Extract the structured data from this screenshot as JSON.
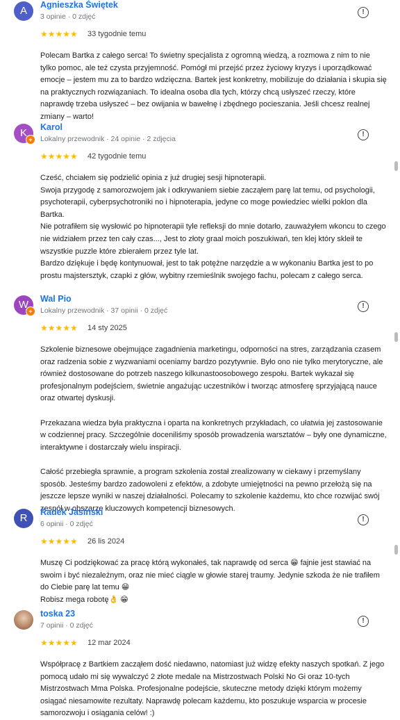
{
  "reviews": [
    {
      "name": "Agnieszka Świętek",
      "avatar_letter": "A",
      "avatar_color": "#4e5fc7",
      "local_guide": false,
      "meta": "3 opinie · 0 zdjęć",
      "stars": "★★★★★",
      "date": "33 tygodnie temu",
      "text": "Polecam Bartka z całego serca! To świetny specjalista z ogromną wiedzą, a rozmowa z nim to nie tylko pomoc, ale też czysta przyjemność. Pomógł mi przejść przez życiowy kryzys i uporządkować emocje – jestem mu za to bardzo wdzięczna. Bartek jest konkretny, mobilizuje do działania i skupia się na praktycznych rozwiązaniach. To idealna osoba dla tych, którzy chcą usłyszeć rzeczy, które naprawdę trzeba usłyszeć – bez owijania w bawełnę i zbędnego pocieszania. Jeśli chcesz realnej zmiany – warto!"
    },
    {
      "name": "Karol",
      "avatar_letter": "K",
      "avatar_color": "#a34fc3",
      "local_guide": true,
      "meta": "Lokalny przewodnik · 24 opinie · 2 zdjęcia",
      "stars": "★★★★★",
      "date": "42 tygodnie temu",
      "text": "Cześć, chciałem się podzielić opinia z już drugiej sesji hipnoterapii.\nSwoja przygodę z samorozwojem jak i odkrywaniem siebie zacząłem parę lat temu, od psychologii, psychoterapii, cyberpsychotroniki no i hipnoterapia, jedyne co moge powiedziec wielki poklon dla Bartka.\nNie potrafiłem się wysłowić po hipnoterapii tyle refleksji do mnie dotarło, zauważyłem wkoncu to czego nie widziałem przez ten cały czas..., Jest to złoty graal moich poszukiwań, ten klej który skleił te wszystkie puzzle które zbierałem przez tyle lat.\nBardzo dziękuje i będę kontynuował, jest to tak potężne narzędzie a w wykonaniu Bartka jest to po prostu majstersztyk, czapki z głów, wybitny rzemieślnik swojego fachu, polecam z całego serca."
    },
    {
      "name": "Wal Pio",
      "avatar_letter": "W",
      "avatar_color": "#9b45bf",
      "local_guide": true,
      "meta": "Lokalny przewodnik · 37 opinii · 0 zdjęć",
      "stars": "★★★★★",
      "date": "14 sty 2025",
      "text": "Szkolenie biznesowe obejmujące zagadnienia marketingu, odporności na stres, zarządzania czasem oraz radzenia sobie z wyzwaniami oceniamy bardzo pozytywnie. Było ono nie tylko merytoryczne, ale również dostosowane do potrzeb naszego kilkunastoosobowego zespołu. Bartek wykazał się profesjonalnym podejściem, świetnie angażując uczestników i tworząc atmosferę sprzyjającą nauce oraz otwartej dyskusji.\n\nPrzekazana wiedza była praktyczna i oparta na konkretnych przykładach, co ułatwia jej zastosowanie w codziennej pracy. Szczególnie doceniliśmy sposób prowadzenia warsztatów – były one dynamiczne, interaktywne i dostarczały wielu inspiracji.\n\nCałość przebiegła sprawnie, a program szkolenia został zrealizowany w ciekawy i przemyślany sposób. Jesteśmy bardzo zadowoleni z efektów, a zdobyte umiejętności na pewno przełożą się na jeszcze lepsze wyniki w naszej działalności. Polecamy to szkolenie każdemu, kto chce rozwijać swój zespół w obszarze kluczowych kompetencji biznesowych."
    },
    {
      "name": "Radek Jasiński",
      "avatar_letter": "R",
      "avatar_color": "#3f51b5",
      "local_guide": false,
      "meta": "6 opinii · 0 zdjęć",
      "stars": "★★★★★",
      "date": "26 lis 2024",
      "text": "Muszę Ci podziękować za pracę którą wykonałeś, tak naprawdę od serca 😁 fajnie jest stawiać na swoim i być niezależnym, oraz nie mieć ciągle w głowie starej traumy. Jedynie szkoda że nie trafiłem do Ciebie parę lat temu 😁\nRobisz mega robotę👌 😁"
    },
    {
      "name": "toska 23",
      "avatar_letter": "",
      "avatar_color": "#c9a58c",
      "local_guide": false,
      "meta": "7 opinii · 0 zdjęć",
      "stars": "★★★★★",
      "date": "12 mar 2024",
      "text": "Współpracę z Bartkiem zacząłem dość niedawno, natomiast już widzę efekty naszych spotkań. Z jego pomocą udało mi się wywalczyć 2 złote medale na Mistrzostwach Polski No Gi oraz 10-tych Mistrzostwach Mma Polska. Profesjonalne podejście, skuteczne metody dzięki którym możemy osiągać niesamowite rezultaty. Naprawdę polecam każdemu, kto poszukuje wsparcia w procesie samorozwoju i osiągania celów! :)"
    }
  ],
  "flag_icon": "report-icon"
}
